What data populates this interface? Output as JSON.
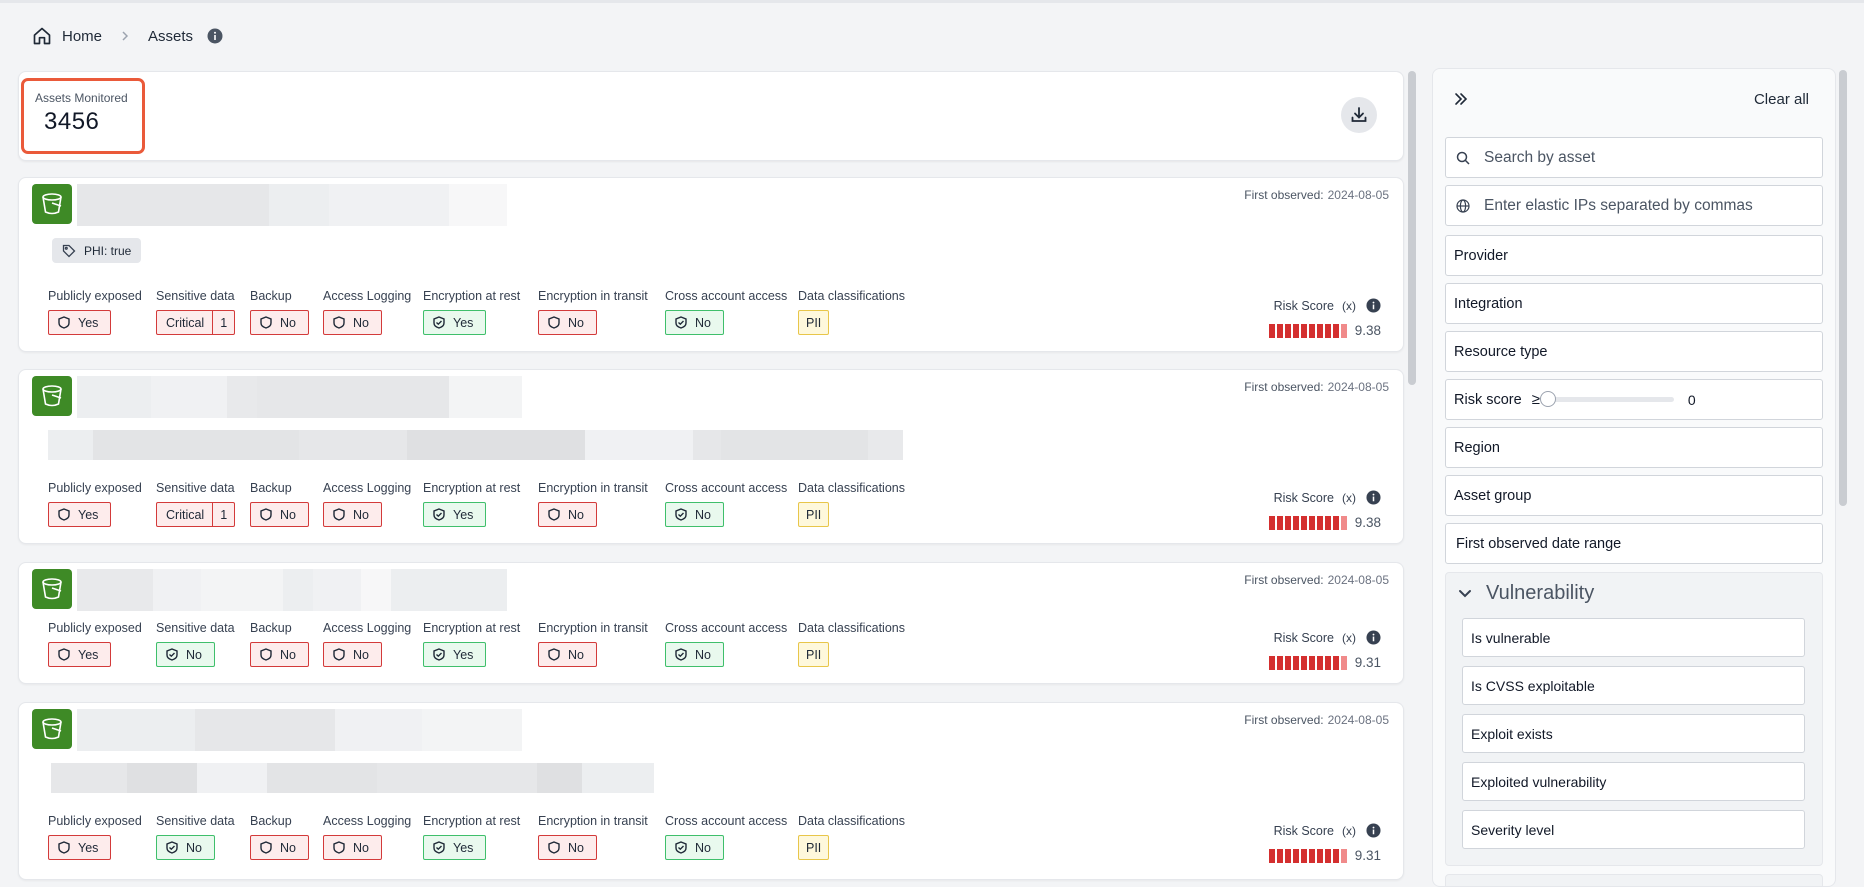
{
  "breadcrumb": {
    "home": "Home",
    "current": "Assets"
  },
  "summary": {
    "label": "Assets Monitored",
    "value": "3456"
  },
  "attribute_labels": {
    "public": "Publicly exposed",
    "sensitive": "Sensitive data",
    "backup": "Backup",
    "logging": "Access Logging",
    "enc_rest": "Encryption at rest",
    "enc_transit": "Encryption in transit",
    "cross": "Cross account access",
    "classif": "Data classifications"
  },
  "risk_label": "Risk Score",
  "risk_fx": "(x)",
  "first_observed_label": "First observed:",
  "assets": [
    {
      "first_observed": "2024-08-05",
      "tag": "PHI: true",
      "public": "Yes",
      "sensitive_level": "Critical",
      "sensitive_count": "1",
      "backup": "No",
      "logging": "No",
      "enc_rest": "Yes",
      "enc_transit": "No",
      "cross": "No",
      "classif": "PII",
      "risk": "9.38"
    },
    {
      "first_observed": "2024-08-05",
      "public": "Yes",
      "sensitive_level": "Critical",
      "sensitive_count": "1",
      "backup": "No",
      "logging": "No",
      "enc_rest": "Yes",
      "enc_transit": "No",
      "cross": "No",
      "classif": "PII",
      "risk": "9.38"
    },
    {
      "first_observed": "2024-08-05",
      "public": "Yes",
      "sensitive": "No",
      "backup": "No",
      "logging": "No",
      "enc_rest": "Yes",
      "enc_transit": "No",
      "cross": "No",
      "classif": "PII",
      "risk": "9.31"
    },
    {
      "first_observed": "2024-08-05",
      "public": "Yes",
      "sensitive": "No",
      "backup": "No",
      "logging": "No",
      "enc_rest": "Yes",
      "enc_transit": "No",
      "cross": "No",
      "classif": "PII",
      "risk": "9.31"
    }
  ],
  "filters": {
    "clear_all": "Clear all",
    "search_placeholder": "Search by asset",
    "ips_placeholder": "Enter elastic IPs separated by commas",
    "provider": "Provider",
    "integration": "Integration",
    "resource_type": "Resource type",
    "risk_score": "Risk score",
    "risk_ge": "≥",
    "risk_value": "0",
    "region": "Region",
    "asset_group": "Asset group",
    "first_observed_range": "First observed date range",
    "vulnerability": {
      "title": "Vulnerability",
      "items": [
        "Is vulnerable",
        "Is CVSS exploitable",
        "Exploit exists",
        "Exploited vulnerability",
        "Severity level"
      ]
    }
  },
  "colors": {
    "accent_red": "#d42f2f",
    "good_green": "#3fbf6b",
    "bucket_green": "#3e8a26",
    "highlight": "#ea5a3a"
  }
}
